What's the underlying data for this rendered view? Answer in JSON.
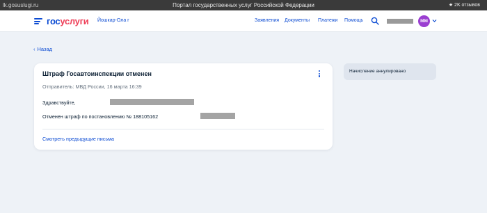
{
  "browser": {
    "url": "lk.gosuslugi.ru",
    "title": "Портал государственных услуг Российской Федерации",
    "reviews": "★ 2K отзывов"
  },
  "header": {
    "logo_part1": "гос",
    "logo_part2": "услуги",
    "region": "Йошкар-Ола г",
    "nav": [
      "Заявления",
      "Документы",
      "Платежи",
      "Помощь"
    ],
    "avatar_initials": "ММ"
  },
  "back_label": "Назад",
  "message": {
    "title": "Штраф Госавтоинспекции отменен",
    "sender": "Отправитель: МВД России, 16 марта 16:39",
    "greeting": "Здравствуйте,",
    "body": "Отменен штраф по постановлению № 188105162",
    "prev_link": "Смотреть предыдущие письма"
  },
  "status_panel": {
    "text": "Начисление аннулировано"
  },
  "colors": {
    "brand_blue": "#0d4cd3",
    "brand_red": "#ee3f58",
    "avatar": "#9b3fd1",
    "page_bg": "#eef2f7"
  }
}
